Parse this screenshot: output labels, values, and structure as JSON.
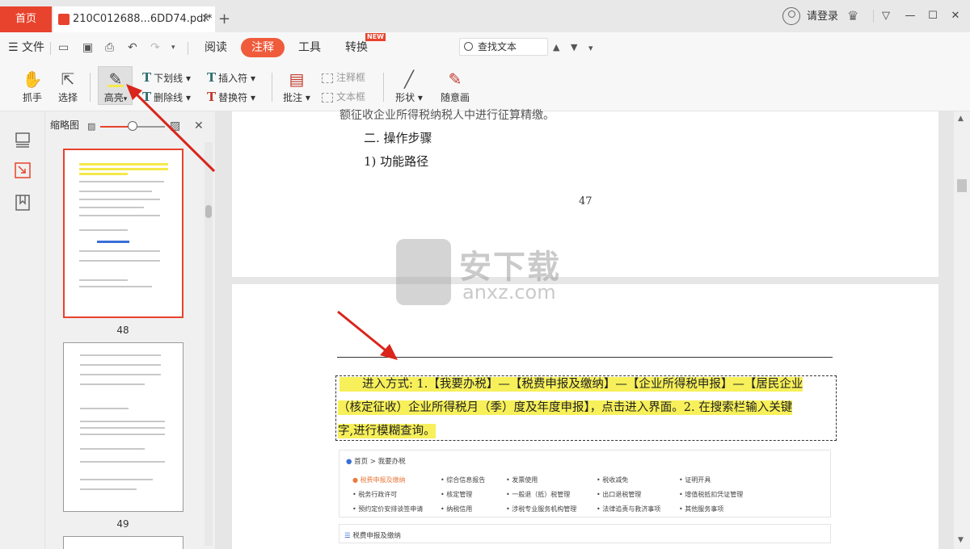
{
  "titlebar": {
    "home_tab": "首页",
    "doc_tab": "210C012688...6DD74.pdf*",
    "close": "✕",
    "add": "+",
    "login": "请登录",
    "minimize": "—",
    "maximize": "☐",
    "close_window": "✕"
  },
  "menu": {
    "file": "文件",
    "read": "阅读",
    "annotate": "注释",
    "tools": "工具",
    "convert": "转换",
    "new_badge": "NEW",
    "search_placeholder": "查找文本"
  },
  "toolbar": {
    "hand": "抓手",
    "select": "选择",
    "highlight": "高亮",
    "underline": "下划线",
    "strikethrough": "删除线",
    "insert": "插入符",
    "replace": "替换符",
    "comment": "批注",
    "note_frame": "注释框",
    "text_box": "文本框",
    "shape": "形状",
    "free_draw": "随意画"
  },
  "thumb_panel": {
    "title": "缩略图",
    "close": "✕",
    "pages": [
      "48",
      "49"
    ],
    "selected": "48"
  },
  "document": {
    "line_prev_partial": "额征收企业所得税纳税人中进行征算精缴。",
    "step_heading": "二.  操作步骤",
    "step_item": "1)   功能路径",
    "page_number": "47",
    "highlight_lines": [
      "进入方式: 1.【我要办税】—【税费申报及缴纳】—【企业所得税申报】—【居民企业",
      "（核定征收）企业所得税月（季）度及年度申报】，点击进入界面。2. 在搜索栏输入关键",
      "字,进行模糊查询。"
    ],
    "web_breadcrumb": "首页 > 我要办税",
    "web_items": [
      [
        "税费申报及缴纳",
        "综合信息报告",
        "发票使用",
        "税收减免",
        "证明开具"
      ],
      [
        "税务行政许可",
        "核定管理",
        "一般退（抵）税管理",
        "出口退税管理",
        "增值税抵扣凭证管理"
      ],
      [
        "预约定价安排谈签申请",
        "纳税信用",
        "涉税专业服务机构管理",
        "法律追责与救济事项",
        "其他服务事项"
      ]
    ],
    "web_section2": "税费申报及缴纳"
  },
  "watermark": {
    "title": "安下载",
    "sub": "anxz.com"
  },
  "colors": {
    "accent": "#e8432c",
    "highlight": "#f7f05a"
  }
}
